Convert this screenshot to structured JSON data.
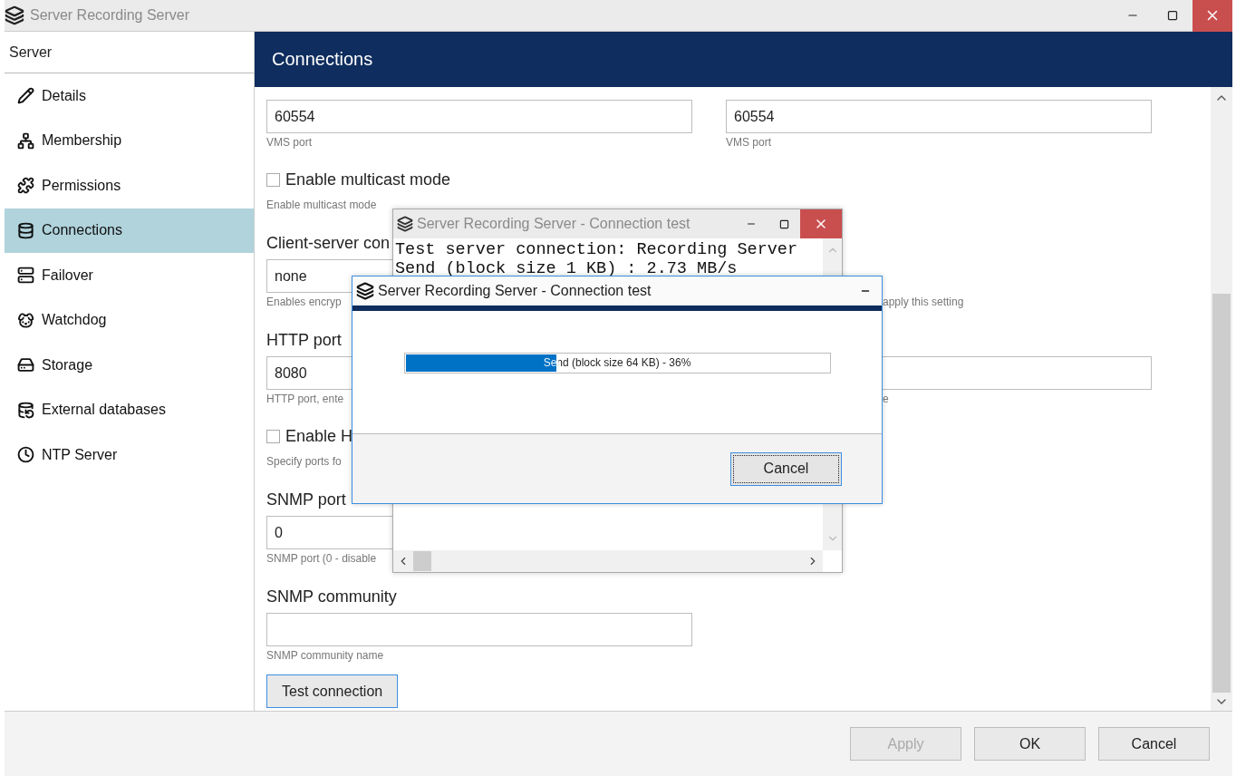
{
  "window": {
    "title": "Server Recording Server"
  },
  "sidebar": {
    "title": "Server",
    "items": [
      {
        "label": "Details",
        "selected": false
      },
      {
        "label": "Membership",
        "selected": false
      },
      {
        "label": "Permissions",
        "selected": false
      },
      {
        "label": "Connections",
        "selected": true
      },
      {
        "label": "Failover",
        "selected": false
      },
      {
        "label": "Watchdog",
        "selected": false
      },
      {
        "label": "Storage",
        "selected": false
      },
      {
        "label": "External databases",
        "selected": false
      },
      {
        "label": "NTP Server",
        "selected": false
      }
    ]
  },
  "panel": {
    "title": "Connections",
    "rows": [
      {
        "kind": "fields",
        "cells": [
          {
            "value": "60554"
          },
          {
            "value": "60554"
          }
        ]
      },
      {
        "kind": "hints",
        "texts": [
          "VMS port",
          "VMS port"
        ]
      },
      {
        "kind": "checkbox",
        "label": "Enable multicast mode",
        "checked": false
      },
      {
        "kind": "hints",
        "texts": [
          "Enable multicast mode"
        ]
      },
      {
        "kind": "label",
        "text": "Client-server con"
      },
      {
        "kind": "fields",
        "cells": [
          {
            "value": "none"
          }
        ]
      },
      {
        "kind": "hints-covered",
        "texts": [
          "Enables encryp",
          "apply this setting"
        ]
      },
      {
        "kind": "label",
        "text": "HTTP port"
      },
      {
        "kind": "fields",
        "cells": [
          {
            "value": "8080"
          },
          {}
        ]
      },
      {
        "kind": "hints-covered",
        "texts": [
          "HTTP port, ente",
          "e"
        ]
      },
      {
        "kind": "checkbox",
        "label": "Enable H",
        "checked": false
      },
      {
        "kind": "hints",
        "texts": [
          "Specify ports fo"
        ]
      },
      {
        "kind": "label",
        "text": "SNMP port"
      },
      {
        "kind": "fields",
        "cells": [
          {
            "value": "0"
          }
        ]
      },
      {
        "kind": "hints",
        "texts": [
          "SNMP port (0 - disable"
        ]
      },
      {
        "kind": "label",
        "text": "SNMP community"
      },
      {
        "kind": "fields",
        "cells": [
          {}
        ]
      },
      {
        "kind": "hints",
        "texts": [
          "SNMP community name"
        ]
      },
      {
        "kind": "button",
        "label": "Test connection"
      }
    ]
  },
  "footer": {
    "buttons": [
      {
        "label": "Apply",
        "disabled": true
      },
      {
        "label": "OK",
        "disabled": false
      },
      {
        "label": "Cancel",
        "disabled": false
      }
    ]
  },
  "log_dialog": {
    "title": "Server Recording Server - Connection test",
    "lines": [
      "Test server connection: Recording Server",
      "Send (block size 1 KB) : 2.73 MB/s"
    ]
  },
  "progress_dialog": {
    "title": "Server Recording Server - Connection test",
    "progress": {
      "label": "Send (block size 64 KB) - 36%",
      "level": 0.36
    },
    "button": "Cancel"
  }
}
